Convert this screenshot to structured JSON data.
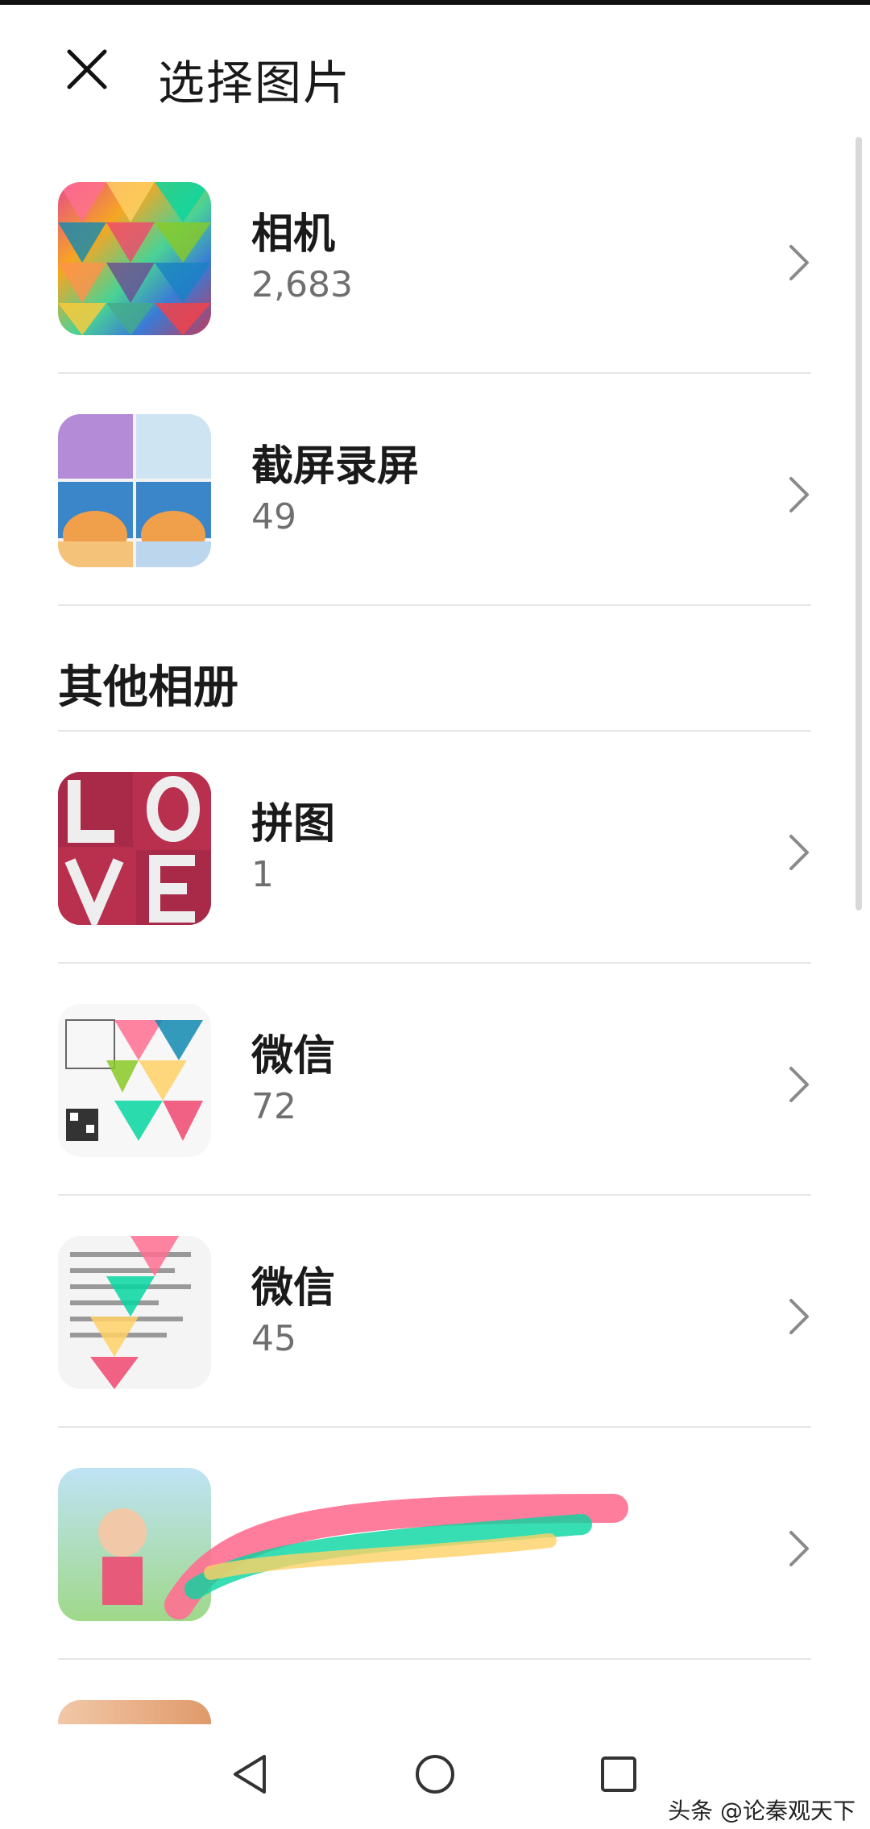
{
  "header": {
    "title": "选择图片",
    "close_icon": "close-icon"
  },
  "albums_top": [
    {
      "name": "相机",
      "count": "2,683"
    },
    {
      "name": "截屏录屏",
      "count": "49"
    }
  ],
  "section": {
    "title": "其他相册"
  },
  "albums_other": [
    {
      "name": "拼图",
      "count": "1"
    },
    {
      "name": "微信",
      "count": "72"
    },
    {
      "name": "微信",
      "count": "45"
    }
  ],
  "nav": {
    "back_icon": "back-triangle-icon",
    "home_icon": "home-circle-icon",
    "recents_icon": "recents-square-icon"
  },
  "watermark": "头条 @论秦观天下",
  "colors": {
    "text_primary": "#1a1a1a",
    "text_secondary": "#6f6f6f",
    "divider": "#e6e6e6",
    "background": "#ffffff",
    "accent_pink": "#c23a5a"
  }
}
